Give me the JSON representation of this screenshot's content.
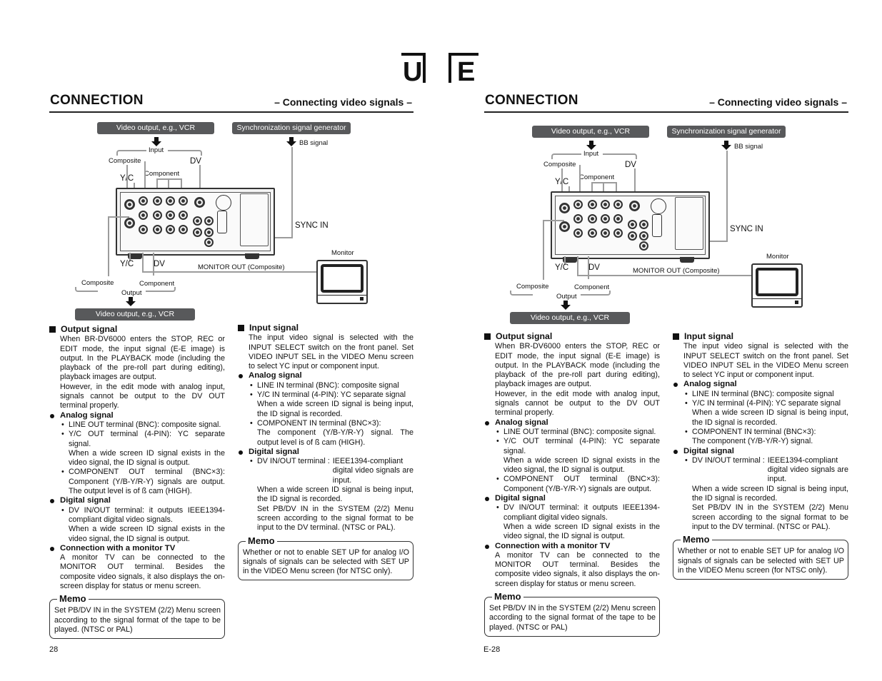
{
  "logo": {
    "left_letter": "U",
    "right_letter": "E"
  },
  "pages": [
    {
      "id": "left",
      "header": {
        "title": "CONNECTION",
        "subtitle": "– Connecting video signals –"
      },
      "diagram": {
        "source_box": "Video output, e.g., VCR",
        "sync_box": "Synchronization signal generator",
        "bb_signal": "BB signal",
        "input": "Input",
        "composite_in": "Composite",
        "dv_in": "DV",
        "yc_in": "Y/C",
        "component_in": "Component",
        "sync_in": "SYNC IN",
        "monitor": "Monitor",
        "yc_out": "Y/C",
        "dv_out": "DV",
        "monitor_out": "MONITOR OUT (Composite)",
        "composite_out": "Composite",
        "component_out": "Component",
        "output": "Output",
        "dest_box": "Video output, e.g., VCR"
      },
      "output_signal": {
        "heading": "Output signal",
        "p1": "When BR-DV6000 enters the STOP, REC or EDIT mode, the input signal (E-E image) is output. In the PLAYBACK mode (including the playback of the pre-roll part during editing), playback images are output.",
        "p2": "However, in the edit mode with analog input, signals cannot be output to the DV OUT terminal properly.",
        "analog": {
          "heading": "Analog signal",
          "items": [
            {
              "text": "LINE OUT terminal (BNC): composite signal."
            },
            {
              "text": "Y/C OUT terminal (4-PIN): YC separate signal.",
              "note": "When a wide screen ID signal exists in the video signal, the ID signal is output."
            },
            {
              "text": "COMPONENT OUT terminal (BNC×3): Component (Y/B-Y/R-Y) signals are output. The output level is of ß cam (HIGH)."
            }
          ]
        },
        "digital": {
          "heading": "Digital signal",
          "items": [
            {
              "text": "DV IN/OUT terminal: it outputs IEEE1394-compliant digital video signals.",
              "note": "When a wide screen ID signal exists in the video signal, the ID signal is output."
            }
          ]
        },
        "monitor": {
          "heading": "Connection with a monitor TV",
          "text": "A monitor TV can be connected to the MONITOR OUT terminal. Besides the composite video signals, it also displays the on-screen display for status or menu screen."
        },
        "memo": {
          "title": "Memo",
          "text": "Set PB/DV IN in the SYSTEM (2/2) Menu screen according to the signal format of the tape to be played. (NTSC or PAL)"
        }
      },
      "input_signal": {
        "heading": "Input signal",
        "p1": "The input video signal is selected with the INPUT SELECT switch on the front panel. Set VIDEO INPUT SEL in the VIDEO Menu screen to select YC input or component input.",
        "analog": {
          "heading": "Analog signal",
          "items": [
            {
              "text": "LINE IN terminal (BNC): composite signal"
            },
            {
              "text": "Y/C IN terminal (4-PIN): YC separate signal",
              "note": "When a wide screen ID signal is being input, the ID signal is recorded."
            },
            {
              "text": "COMPONENT IN terminal (BNC×3):",
              "note": "The component (Y/B-Y/R-Y) signal. The output level is of ß cam (HIGH)."
            }
          ]
        },
        "digital": {
          "heading": "Digital signal",
          "term": "DV IN/OUT terminal :",
          "desc": "IEEE1394-compliant digital video signals are input.",
          "note1": "When a wide screen ID signal is being input, the ID signal is recorded.",
          "note2": "Set PB/DV IN in the SYSTEM (2/2) Menu screen according to the signal format to be input to the DV terminal. (NTSC or PAL)."
        },
        "memo": {
          "title": "Memo",
          "text": "Whether or not to enable SET UP for analog I/O signals of signals can be selected with SET UP in the VIDEO Menu screen (for NTSC only)."
        }
      },
      "page_number": "28"
    },
    {
      "id": "right",
      "header": {
        "title": "CONNECTION",
        "subtitle": "– Connecting video signals –"
      },
      "diagram": {
        "source_box": "Video output, e.g., VCR",
        "sync_box": "Synchronization signal generator",
        "bb_signal": "BB signal",
        "input": "Input",
        "composite_in": "Composite",
        "dv_in": "DV",
        "yc_in": "Y/C",
        "component_in": "Component",
        "sync_in": "SYNC IN",
        "monitor": "Monitor",
        "yc_out": "Y/C",
        "dv_out": "DV",
        "monitor_out": "MONITOR OUT (Composite)",
        "composite_out": "Composite",
        "component_out": "Component",
        "output": "Output",
        "dest_box": "Video output, e.g., VCR"
      },
      "output_signal": {
        "heading": "Output signal",
        "p1": "When BR-DV6000 enters the STOP, REC or EDIT mode, the input signal (E-E image) is output. In the PLAYBACK mode (including the playback of the pre-roll part during editing), playback images are output.",
        "p2": "However, in the edit mode with analog input, signals cannot be output to the DV OUT terminal properly.",
        "analog": {
          "heading": "Analog signal",
          "items": [
            {
              "text": "LINE OUT terminal (BNC): composite signal."
            },
            {
              "text": "Y/C OUT terminal (4-PIN): YC separate signal.",
              "note": "When a wide screen ID signal exists in the video signal, the ID signal is output."
            },
            {
              "text": "COMPONENT OUT terminal (BNC×3): Component (Y/B-Y/R-Y) signals are output."
            }
          ]
        },
        "digital": {
          "heading": "Digital signal",
          "items": [
            {
              "text": "DV IN/OUT terminal: it outputs IEEE1394-compliant digital video signals.",
              "note": "When a wide screen ID signal exists in the video signal, the ID signal is output."
            }
          ]
        },
        "monitor": {
          "heading": "Connection with a monitor TV",
          "text": "A monitor TV can be connected to the MONITOR OUT terminal. Besides the composite video signals, it also displays the on-screen display for status or menu screen."
        },
        "memo": {
          "title": "Memo",
          "text": "Set PB/DV IN in the SYSTEM (2/2) Menu screen according to the signal format of the tape to be played. (NTSC or PAL)"
        }
      },
      "input_signal": {
        "heading": "Input signal",
        "p1": "The input video signal is selected with the INPUT SELECT switch on the front panel. Set VIDEO INPUT SEL in the VIDEO Menu screen to select YC input or component input.",
        "analog": {
          "heading": "Analog signal",
          "items": [
            {
              "text": "LINE IN terminal (BNC): composite signal"
            },
            {
              "text": "Y/C IN terminal (4-PIN): YC separate signal",
              "note": "When a wide screen ID signal is being input, the ID signal is recorded."
            },
            {
              "text": "COMPONENT IN terminal (BNC×3):",
              "note": "The component (Y/B-Y/R-Y) signal."
            }
          ]
        },
        "digital": {
          "heading": "Digital signal",
          "term": "DV IN/OUT terminal :",
          "desc": "IEEE1394-compliant digital video signals are input.",
          "note1": "When a wide screen ID signal is being input, the ID signal is recorded.",
          "note2": "Set PB/DV IN in the SYSTEM (2/2) Menu screen according to the signal format to be input to the DV terminal. (NTSC or PAL)."
        },
        "memo": {
          "title": "Memo",
          "text": "Whether or not to enable SET UP for analog I/O signals of signals can be selected with SET UP in the VIDEO Menu screen (for NTSC only)."
        }
      },
      "page_number": "E-28"
    }
  ]
}
